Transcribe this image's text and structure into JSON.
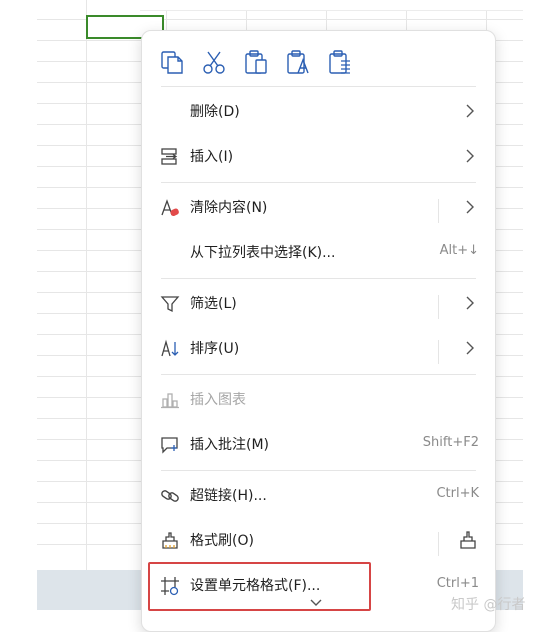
{
  "quick_actions": [
    {
      "name": "copy-icon"
    },
    {
      "name": "cut-icon"
    },
    {
      "name": "paste-icon"
    },
    {
      "name": "paste-text-icon"
    },
    {
      "name": "paste-special-icon"
    }
  ],
  "menu": {
    "delete": {
      "label": "删除(D)",
      "icon": ""
    },
    "insert": {
      "label": "插入(I)",
      "icon": "insert-icon"
    },
    "clear": {
      "label": "清除内容(N)",
      "icon": "eraser-icon"
    },
    "pick_list": {
      "label": "从下拉列表中选择(K)...",
      "shortcut": "Alt+↓"
    },
    "filter": {
      "label": "筛选(L)",
      "icon": "filter-icon"
    },
    "sort": {
      "label": "排序(U)",
      "icon": "sort-icon"
    },
    "insert_chart": {
      "label": "插入图表",
      "icon": "chart-icon",
      "disabled": true
    },
    "insert_comment": {
      "label": "插入批注(M)",
      "shortcut": "Shift+F2",
      "icon": "comment-icon"
    },
    "hyperlink": {
      "label": "超链接(H)...",
      "shortcut": "Ctrl+K",
      "icon": "link-icon"
    },
    "format_painter": {
      "label": "格式刷(O)",
      "icon": "format-painter-icon"
    },
    "format_cells": {
      "label": "设置单元格格式(F)...",
      "shortcut": "Ctrl+1",
      "icon": "format-cells-icon"
    }
  },
  "colors": {
    "highlight": "#d64545",
    "selected_cell": "#3a8a2a"
  },
  "watermark": "知乎 @行者"
}
